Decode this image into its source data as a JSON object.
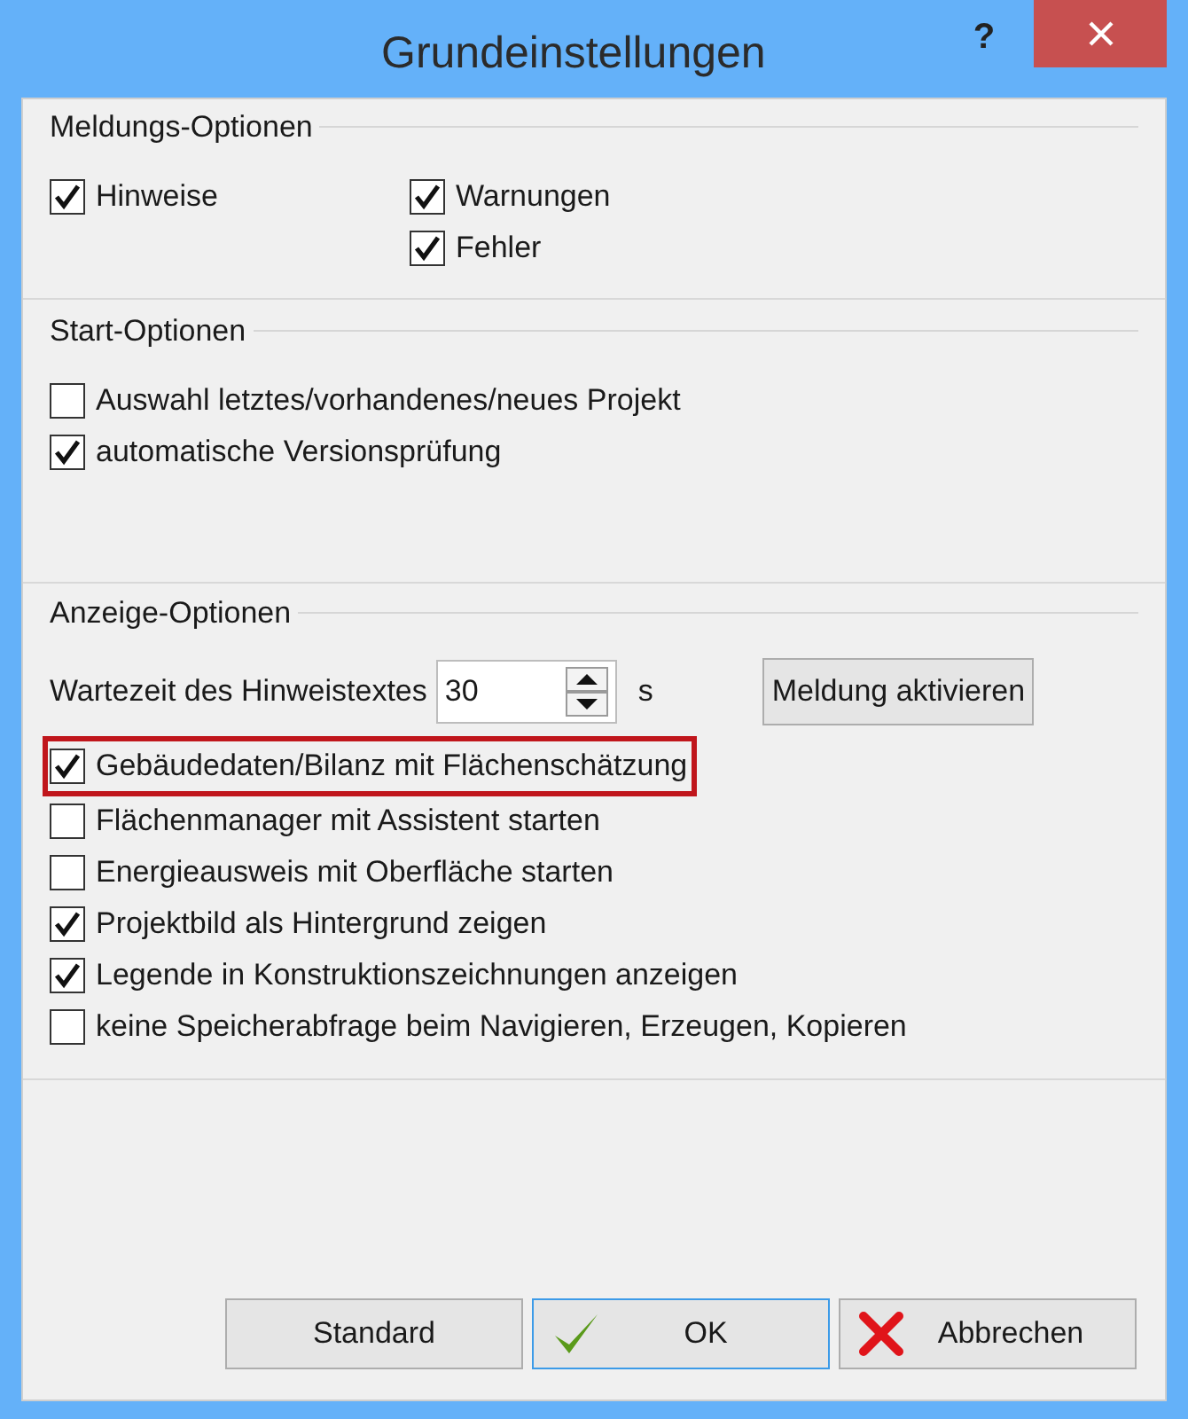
{
  "window": {
    "title": "Grundeinstellungen",
    "help": "?"
  },
  "message_options": {
    "title": "Meldungs-Optionen",
    "columns": [
      [
        {
          "label": "Hinweise",
          "checked": true
        }
      ],
      [
        {
          "label": "Warnungen",
          "checked": true
        },
        {
          "label": "Fehler",
          "checked": true
        }
      ]
    ]
  },
  "start_options": {
    "title": "Start-Optionen",
    "items": [
      {
        "label": "Auswahl letztes/vorhandenes/neues Projekt",
        "checked": false
      },
      {
        "label": "automatische Versionsprüfung",
        "checked": true
      }
    ]
  },
  "display_options": {
    "title": "Anzeige-Optionen",
    "wait_label": "Wartezeit des Hinweistextes",
    "wait_value": "30",
    "wait_unit": "s",
    "activate_button": "Meldung aktivieren",
    "items": [
      {
        "label": "Gebäudedaten/Bilanz mit Flächenschätzung",
        "checked": true,
        "highlighted": true
      },
      {
        "label": "Flächenmanager mit Assistent starten",
        "checked": false,
        "highlighted": false
      },
      {
        "label": "Energieausweis mit Oberfläche starten",
        "checked": false,
        "highlighted": false
      },
      {
        "label": "Projektbild als Hintergrund zeigen",
        "checked": true,
        "highlighted": false
      },
      {
        "label": "Legende in Konstruktionszeichnungen anzeigen",
        "checked": true,
        "highlighted": false
      },
      {
        "label": "keine Speicherabfrage beim Navigieren, Erzeugen, Kopieren",
        "checked": false,
        "highlighted": false
      }
    ]
  },
  "buttons": [
    {
      "label": "Standard",
      "kind": "plain",
      "default": false
    },
    {
      "label": "OK",
      "kind": "ok",
      "default": true
    },
    {
      "label": "Abbrechen",
      "kind": "cancel",
      "default": false
    }
  ]
}
